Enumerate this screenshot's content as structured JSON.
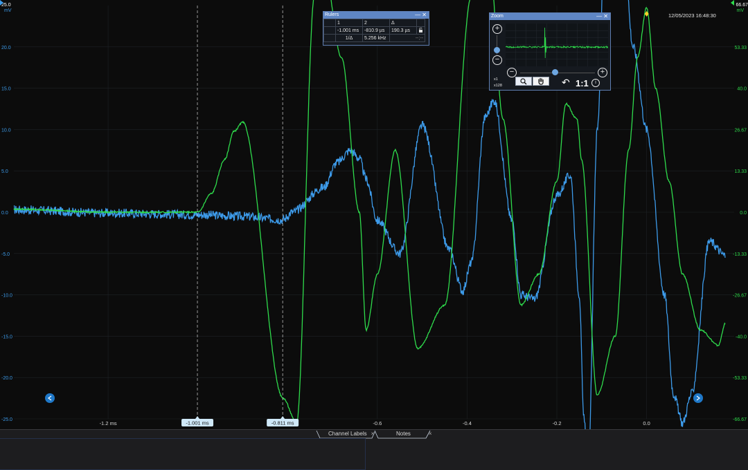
{
  "timestamp": "12/05/2023 16:48:30",
  "colors": {
    "ch1": "#3d9bea",
    "ch2": "#2fdc4c",
    "ruler": "#d0d0d0",
    "label_bg": "#cfe8f8"
  },
  "chart_data": {
    "type": "line",
    "xlim": [
      -1.41,
      0.195
    ],
    "x_ticks": [
      {
        "value": -1.2,
        "label": "-1.2 ms"
      },
      {
        "value": -0.6,
        "label": "-0.6"
      },
      {
        "value": -0.4,
        "label": "-0.4"
      },
      {
        "value": -0.2,
        "label": "-0.2"
      },
      {
        "value": 0.0,
        "label": "0.0"
      }
    ],
    "left_axis": {
      "unit": "mV",
      "top_label": "25.0",
      "ylim": [
        -25,
        25
      ],
      "ticks": [
        {
          "value": 20,
          "label": "20.0"
        },
        {
          "value": 15,
          "label": "15.0"
        },
        {
          "value": 10,
          "label": "10.0"
        },
        {
          "value": 5,
          "label": "5.0"
        },
        {
          "value": 0,
          "label": "0.0"
        },
        {
          "value": -5,
          "label": "-5.0"
        },
        {
          "value": -10,
          "label": "-10.0"
        },
        {
          "value": -15,
          "label": "-15.0"
        },
        {
          "value": -20,
          "label": "-20.0"
        },
        {
          "value": -25,
          "label": "-25.0"
        }
      ]
    },
    "right_axis": {
      "unit": "mV",
      "top_label": "66.67",
      "ylim": [
        -66.67,
        66.67
      ],
      "ticks": [
        {
          "value": 53.33,
          "label": "53.33"
        },
        {
          "value": 40,
          "label": "40.0"
        },
        {
          "value": 26.67,
          "label": "26.67"
        },
        {
          "value": 13.33,
          "label": "13.33"
        },
        {
          "value": 0,
          "label": "0.0"
        },
        {
          "value": -13.33,
          "label": "-13.33"
        },
        {
          "value": -26.67,
          "label": "-26.67"
        },
        {
          "value": -40,
          "label": "-40.0"
        },
        {
          "value": -53.33,
          "label": "-53.33"
        },
        {
          "value": -66.67,
          "label": "-66.67"
        }
      ]
    },
    "series": [
      {
        "axis": "left",
        "color": "#3d9bea",
        "noise": 0.55,
        "x": [
          -1.41,
          -1.2,
          -1.0,
          -0.9,
          -0.81,
          -0.79,
          -0.72,
          -0.69,
          -0.66,
          -0.64,
          -0.625,
          -0.6,
          -0.55,
          -0.5,
          -0.44,
          -0.41,
          -0.39,
          -0.36,
          -0.34,
          -0.3,
          -0.28,
          -0.25,
          -0.2,
          -0.17,
          -0.15,
          -0.14,
          -0.13,
          -0.11,
          -0.09,
          -0.06,
          -0.03,
          0.0,
          0.04,
          0.06,
          0.08,
          0.1,
          0.14,
          0.175
        ],
        "y": [
          0.3,
          -0.1,
          -0.3,
          -0.5,
          -0.9,
          0.0,
          3.0,
          6.0,
          7.5,
          6.5,
          4.0,
          -1.0,
          -5.0,
          10.5,
          -4.5,
          -9.5,
          -6.0,
          11.5,
          13.5,
          -1.0,
          -10.0,
          -10.5,
          2.0,
          4.5,
          -10.0,
          -25.0,
          -30.0,
          10.0,
          40.0,
          40.0,
          20.0,
          10.0,
          -10.0,
          -22.0,
          -25.5,
          -22.0,
          -3.5,
          -5.2
        ]
      },
      {
        "axis": "right",
        "color": "#2fdc4c",
        "noise": 0.25,
        "x": [
          -1.41,
          -1.2,
          -1.0,
          -0.97,
          -0.94,
          -0.92,
          -0.9,
          -0.81,
          -0.78,
          -0.74,
          -0.72,
          -0.68,
          -0.64,
          -0.625,
          -0.6,
          -0.56,
          -0.51,
          -0.45,
          -0.39,
          -0.35,
          -0.32,
          -0.28,
          -0.24,
          -0.2,
          -0.18,
          -0.155,
          -0.145,
          -0.11,
          -0.07,
          -0.04,
          -0.02,
          0.0,
          0.02,
          0.05,
          0.08,
          0.12,
          0.16,
          0.175
        ],
        "y": [
          1.0,
          0.0,
          0.0,
          6.0,
          17.0,
          26.0,
          29.0,
          -60.0,
          -68.0,
          70.0,
          80.0,
          50.0,
          0.0,
          -38.0,
          -20.0,
          20.0,
          -44.0,
          -30.0,
          70.0,
          80.0,
          30.0,
          -30.0,
          -20.0,
          10.0,
          35.0,
          30.0,
          17.0,
          -59.0,
          -40.0,
          20.0,
          50.0,
          66.0,
          40.0,
          10.0,
          -20.0,
          -38.0,
          -43.0,
          -36.0
        ]
      }
    ],
    "rulers": [
      {
        "value": -1.001,
        "label": "-1.001 ms"
      },
      {
        "value": -0.811,
        "label": "-0.811 ms"
      }
    ],
    "trigger_marker": {
      "value": 0.0
    }
  },
  "rulers_window": {
    "title": "Rulers",
    "headers": [
      "1",
      "2",
      "Δ"
    ],
    "values": [
      "-1.001 ms",
      "-810.9 µs",
      "190.3 µs"
    ],
    "inv_label": "1/Δ",
    "inv_value": "5.256 kHz",
    "inv_extra": "--;--"
  },
  "zoom_window": {
    "title": "Zoom",
    "x1_label": "x1",
    "x128_label": "x128",
    "ratio": "1:1",
    "undo_icon": "undo-icon",
    "magnify_icon": "magnify-icon",
    "hand_icon": "hand-icon",
    "info_icon": "info-icon"
  },
  "tabs": {
    "channel_labels": "Channel Labels",
    "notes": "Notes",
    "close": "×"
  },
  "window_controls": {
    "minimize": "—",
    "close": "✕"
  }
}
